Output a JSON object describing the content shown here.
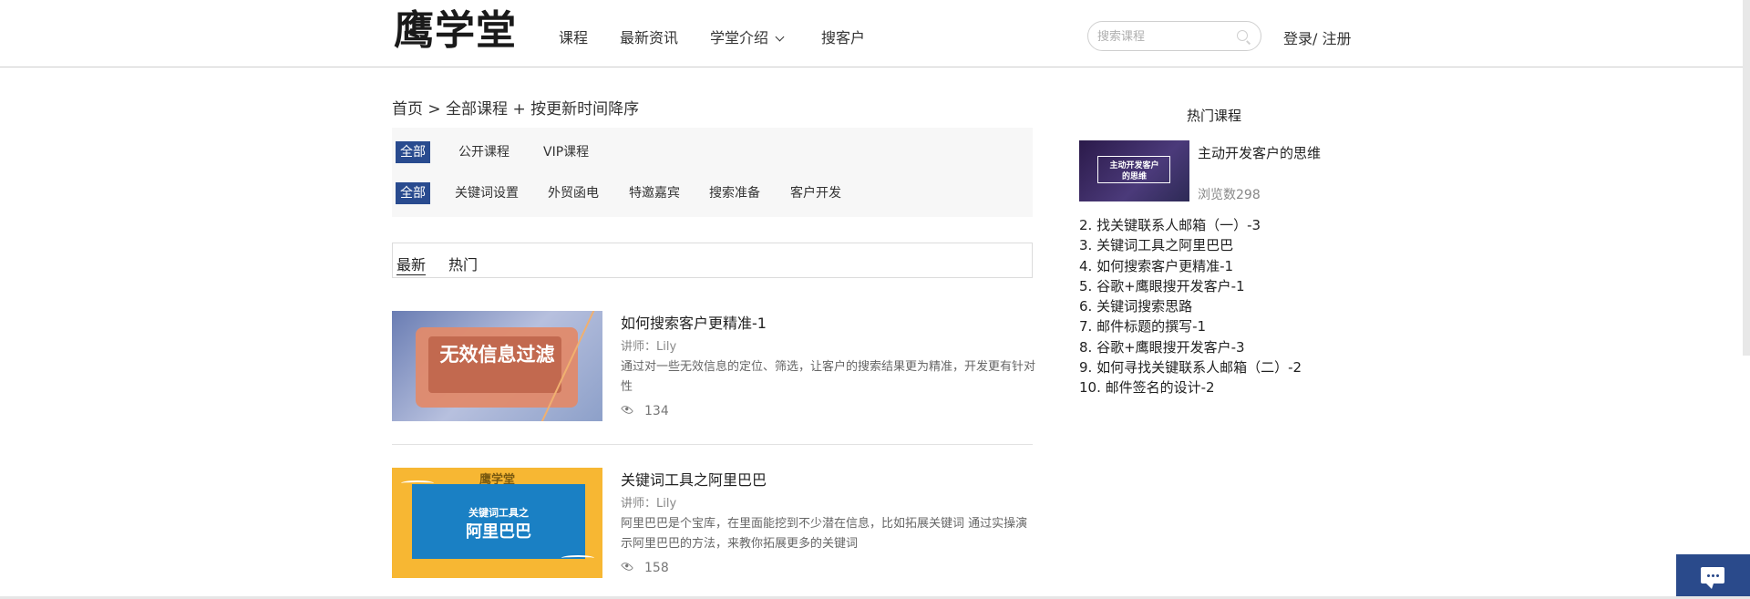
{
  "header": {
    "logo": "鹰学堂",
    "nav": [
      {
        "label": "课程"
      },
      {
        "label": "最新资讯"
      },
      {
        "label": "学堂介绍"
      },
      {
        "label": "搜客户"
      }
    ],
    "search_placeholder": "搜索课程",
    "login": "登录/ 注册"
  },
  "breadcrumb": "首页 > 全部课程 + 按更新时间降序",
  "filters": {
    "type": [
      "全部",
      "公开课程",
      "VIP课程"
    ],
    "category": [
      "全部",
      "关键词设置",
      "外贸函电",
      "特邀嘉宾",
      "搜索准备",
      "客户开发"
    ]
  },
  "sort_tabs": [
    "最新",
    "热门"
  ],
  "courses": [
    {
      "title": "如何搜索客户更精准-1",
      "lecturer": "讲师：Lily",
      "desc": "通过对一些无效信息的定位、筛选，让客户的搜索结果更为精准，开发更有针对性",
      "views": "134",
      "thumb_text": "无效信息过滤"
    },
    {
      "title": "关键词工具之阿里巴巴",
      "lecturer": "讲师：Lily",
      "desc": "阿里巴巴是个宝库，在里面能挖到不少潜在信息，比如拓展关键词 通过实操演示阿里巴巴的方法，来教你拓展更多的关键词",
      "views": "158",
      "thumb_top": "鹰学堂",
      "thumb_line1": "关键词工具之",
      "thumb_line2": "阿里巴巴"
    }
  ],
  "sidebar": {
    "title": "热门课程",
    "first": {
      "title": "主动开发客户的思维",
      "views": "浏览数298",
      "thumb_line1": "主动开发客户",
      "thumb_line2": "的思维"
    },
    "list": [
      "2. 找关键联系人邮箱（一）-3",
      "3. 关键词工具之阿里巴巴",
      "4. 如何搜索客户更精准-1",
      "5. 谷歌+鹰眼搜开发客户-1",
      "6. 关键词搜索思路",
      "7. 邮件标题的撰写-1",
      "8. 谷歌+鹰眼搜开发客户-3",
      "9. 如何寻找关键联系人邮箱（二）-2",
      "10. 邮件签名的设计-2"
    ]
  },
  "colors": {
    "accent": "#294b8f",
    "chat": "#2a4a8b"
  }
}
